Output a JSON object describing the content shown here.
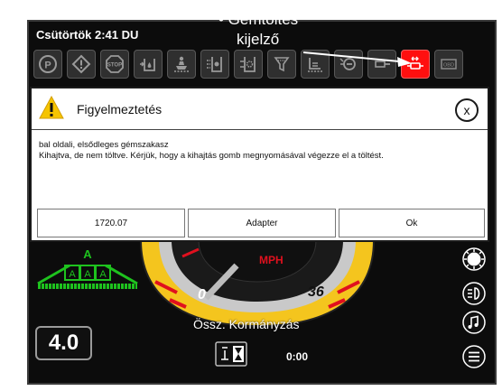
{
  "status_bar": {
    "datetime": "Csütörtök 2:41 DU"
  },
  "callout": {
    "line1": "• Gémtöltés",
    "line2": "kijelző"
  },
  "toolbar": {
    "icons": [
      "parking-brake-icon",
      "warning-icon",
      "stop-icon",
      "tank-fill-icon",
      "operator-seat-icon",
      "hydraulic-icon",
      "fan-icon",
      "filter-icon",
      "spray-icon",
      "gear-icon",
      "boom-fill-icon",
      "obd-icon"
    ],
    "active_icon": "boom-fill-icon",
    "last_icon_label": "OBD"
  },
  "dialog": {
    "title": "Figyelmeztetés",
    "close_label": "x",
    "message_line1": "bal oldali, elsődleges gémszakasz",
    "message_line2": "Kihajtva, de nem töltve. Kérjük, hogy a kihajtás gomb megnyomásával végezze el a töltést.",
    "buttons": [
      "1720.07",
      "Adapter",
      "Ok"
    ]
  },
  "boom_display": {
    "top_letter": "A",
    "sections": [
      "A",
      "A",
      "A"
    ]
  },
  "speedometer": {
    "unit": "MPH",
    "min_label": "0",
    "max_label": "36",
    "speed_fraction": 0.0,
    "label": "Össz. Kormányzás"
  },
  "version": {
    "value": "4.0"
  },
  "timer": {
    "value": "0:00"
  },
  "side_buttons": [
    "brightness-icon",
    "headlight-icon",
    "music-icon",
    "menu-icon"
  ],
  "colors": {
    "accent_red": "#ff0f0f",
    "gauge_yellow": "#f4c51e",
    "boom_green": "#1ec21e",
    "warning_yellow": "#f5c400"
  }
}
